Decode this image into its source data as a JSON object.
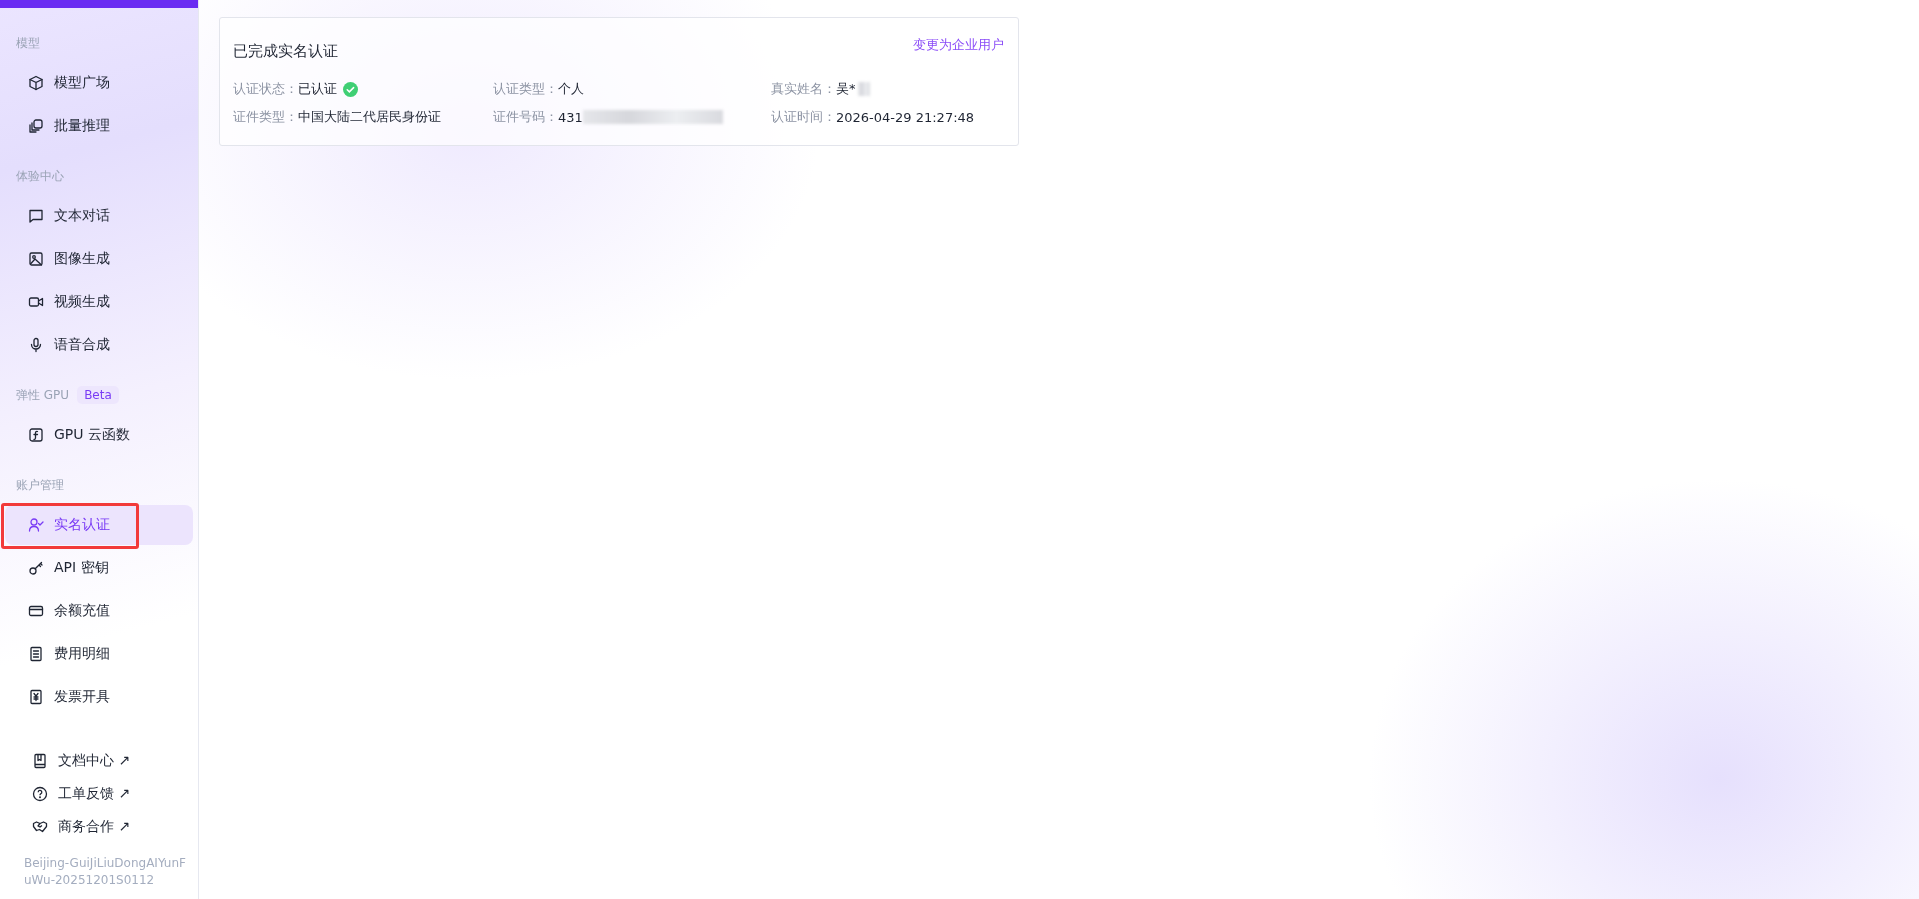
{
  "sidebar": {
    "sections": [
      {
        "label": "模型",
        "items": [
          {
            "label": "模型广场",
            "kind": "cube",
            "selected": false
          },
          {
            "label": "批量推理",
            "kind": "copies",
            "selected": false
          }
        ]
      },
      {
        "label": "体验中心",
        "items": [
          {
            "label": "文本对话",
            "kind": "chat",
            "selected": false
          },
          {
            "label": "图像生成",
            "kind": "image",
            "selected": false
          },
          {
            "label": "视频生成",
            "kind": "video",
            "selected": false
          },
          {
            "label": "语音合成",
            "kind": "mic",
            "selected": false
          }
        ]
      },
      {
        "label": "弹性 GPU",
        "badge": "Beta",
        "items": [
          {
            "label": "GPU 云函数",
            "kind": "function",
            "selected": false
          }
        ]
      },
      {
        "label": "账户管理",
        "items": [
          {
            "label": "实名认证",
            "kind": "user-check",
            "selected": true
          },
          {
            "label": "API 密钥",
            "kind": "key",
            "selected": false
          },
          {
            "label": "余额充值",
            "kind": "card",
            "selected": false
          },
          {
            "label": "费用明细",
            "kind": "receipt",
            "selected": false
          },
          {
            "label": "发票开具",
            "kind": "invoice",
            "selected": false
          }
        ]
      }
    ],
    "links": [
      {
        "label": "文档中心 ↗",
        "kind": "book"
      },
      {
        "label": "工单反馈 ↗",
        "kind": "help"
      },
      {
        "label": "商务合作 ↗",
        "kind": "handshake"
      }
    ],
    "footer": "Beijing-GuiJiLiuDongAIYunFuWu-20251201S0112"
  },
  "card": {
    "title": "已完成实名认证",
    "action": "变更为企业用户",
    "fields": [
      {
        "label": "认证状态：",
        "value": "已认证",
        "verified": true
      },
      {
        "label": "认证类型：",
        "value": "个人"
      },
      {
        "label": "真实姓名：",
        "value": "吴*",
        "blurred": true
      },
      {
        "label": "证件类型：",
        "value": "中国大陆二代居民身份证"
      },
      {
        "label": "证件号码：",
        "value": "431",
        "blurred": true
      },
      {
        "label": "认证时间：",
        "value": "2026-04-29 21:27:48"
      }
    ]
  }
}
